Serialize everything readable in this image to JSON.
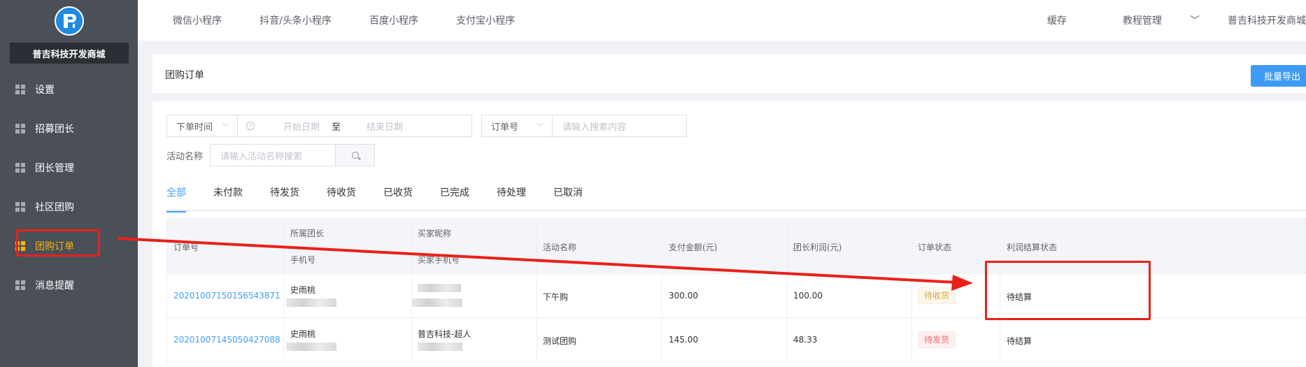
{
  "sidebar": {
    "shop_name": "普吉科技开发商城",
    "items": [
      {
        "label": "设置"
      },
      {
        "label": "招募团长"
      },
      {
        "label": "团长管理"
      },
      {
        "label": "社区团购"
      },
      {
        "label": "团购订单"
      },
      {
        "label": "消息提醒"
      }
    ],
    "active_index": 4
  },
  "topbar": {
    "nav": [
      "微信小程序",
      "抖音/头条小程序",
      "百度小程序",
      "支付宝小程序"
    ],
    "cache": "缓存",
    "tutorial": "教程管理",
    "account": "普吉科技开发商城"
  },
  "header": {
    "title": "团购订单",
    "export_button": "批量导出"
  },
  "filters": {
    "time_select": "下单时间",
    "start_date_placeholder": "开始日期",
    "range_separator": "至",
    "end_date_placeholder": "结束日期",
    "order_select": "订单号",
    "search_placeholder": "请输入搜索内容",
    "activity_label": "活动名称",
    "activity_placeholder": "请输入活动名称搜索"
  },
  "tabs": [
    "全部",
    "未付款",
    "待发货",
    "待收货",
    "已收货",
    "已完成",
    "待处理",
    "已取消"
  ],
  "table": {
    "headers": {
      "order_no": "订单号",
      "leader": "所属团长",
      "phone": "手机号",
      "buyer_nick": "买家昵称",
      "buyer_phone": "买家手机号",
      "activity": "活动名称",
      "amount": "支付金额(元)",
      "profit": "团长利润(元)",
      "status": "订单状态",
      "settle": "利润结算状态"
    },
    "rows": [
      {
        "order_no": "20201007150156543871",
        "leader": "史雨桃",
        "buyer": "",
        "activity": "下午购",
        "amount": "300.00",
        "profit": "100.00",
        "status": "待收货",
        "settle": "待结算"
      },
      {
        "order_no": "20201007145050427088",
        "leader": "史雨桃",
        "buyer": "普吉科技-超人",
        "activity": "测试团购",
        "amount": "145.00",
        "profit": "48.33",
        "status": "待发货",
        "settle": "待结算"
      }
    ]
  },
  "colors": {
    "sidebar_bg": "#4a4f58",
    "active": "#f7b500",
    "primary": "#409eff",
    "annotation": "#e8211a"
  }
}
